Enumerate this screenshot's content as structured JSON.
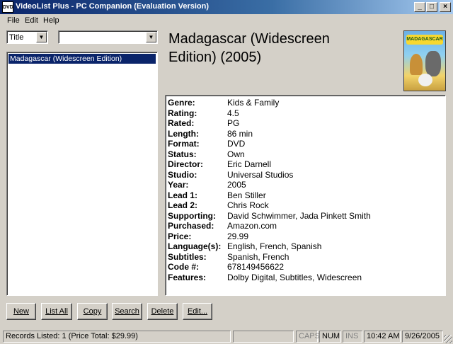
{
  "window": {
    "icon_text": "DVD",
    "title": "VideoList Plus - PC Companion (Evaluation Version)",
    "minimize": "_",
    "maximize": "□",
    "close": "×"
  },
  "menu": [
    "File",
    "Edit",
    "Help"
  ],
  "filter": {
    "field_value": "Title",
    "search_value": ""
  },
  "list": {
    "items": [
      "Madagascar (Widescreen Edition)"
    ],
    "selected_index": 0
  },
  "movie": {
    "title_line1": "Madagascar (Widescreen",
    "title_line2": "Edition) (2005)",
    "cover_logo": "MADAGASCAR"
  },
  "details": [
    {
      "label": "Genre:",
      "value": "Kids & Family"
    },
    {
      "label": "Rating:",
      "value": "4.5"
    },
    {
      "label": "Rated:",
      "value": "PG"
    },
    {
      "label": "Length:",
      "value": "86 min"
    },
    {
      "label": "Format:",
      "value": "DVD"
    },
    {
      "label": "Status:",
      "value": "Own"
    },
    {
      "label": "Director:",
      "value": "Eric Darnell"
    },
    {
      "label": "Studio:",
      "value": "Universal Studios"
    },
    {
      "label": "Year:",
      "value": "2005"
    },
    {
      "label": "Lead 1:",
      "value": "Ben Stiller"
    },
    {
      "label": "Lead 2:",
      "value": "Chris Rock"
    },
    {
      "label": "Supporting:",
      "value": "David Schwimmer, Jada Pinkett Smith"
    },
    {
      "label": "Purchased:",
      "value": "Amazon.com"
    },
    {
      "label": "Price:",
      "value": "29.99"
    },
    {
      "label": "Language(s):",
      "value": "English, French, Spanish"
    },
    {
      "label": "Subtitles:",
      "value": "Spanish, French"
    },
    {
      "label": "Code #:",
      "value": "678149456622"
    },
    {
      "label": "Features:",
      "value": "Dolby Digital, Subtitles, Widescreen"
    }
  ],
  "buttons": {
    "new": "New",
    "list_all": "List All",
    "copy": "Copy",
    "search": "Search",
    "delete": "Delete",
    "edit": "Edit..."
  },
  "status": {
    "records": "Records Listed: 1  (Price Total: $29.99)",
    "caps": "CAPS",
    "num": "NUM",
    "ins": "INS",
    "time": "10:42 AM",
    "date": "9/26/2005"
  },
  "colors": {
    "title_bar": "#0a246a",
    "selection": "#0a246a",
    "face": "#d4d0c8"
  }
}
